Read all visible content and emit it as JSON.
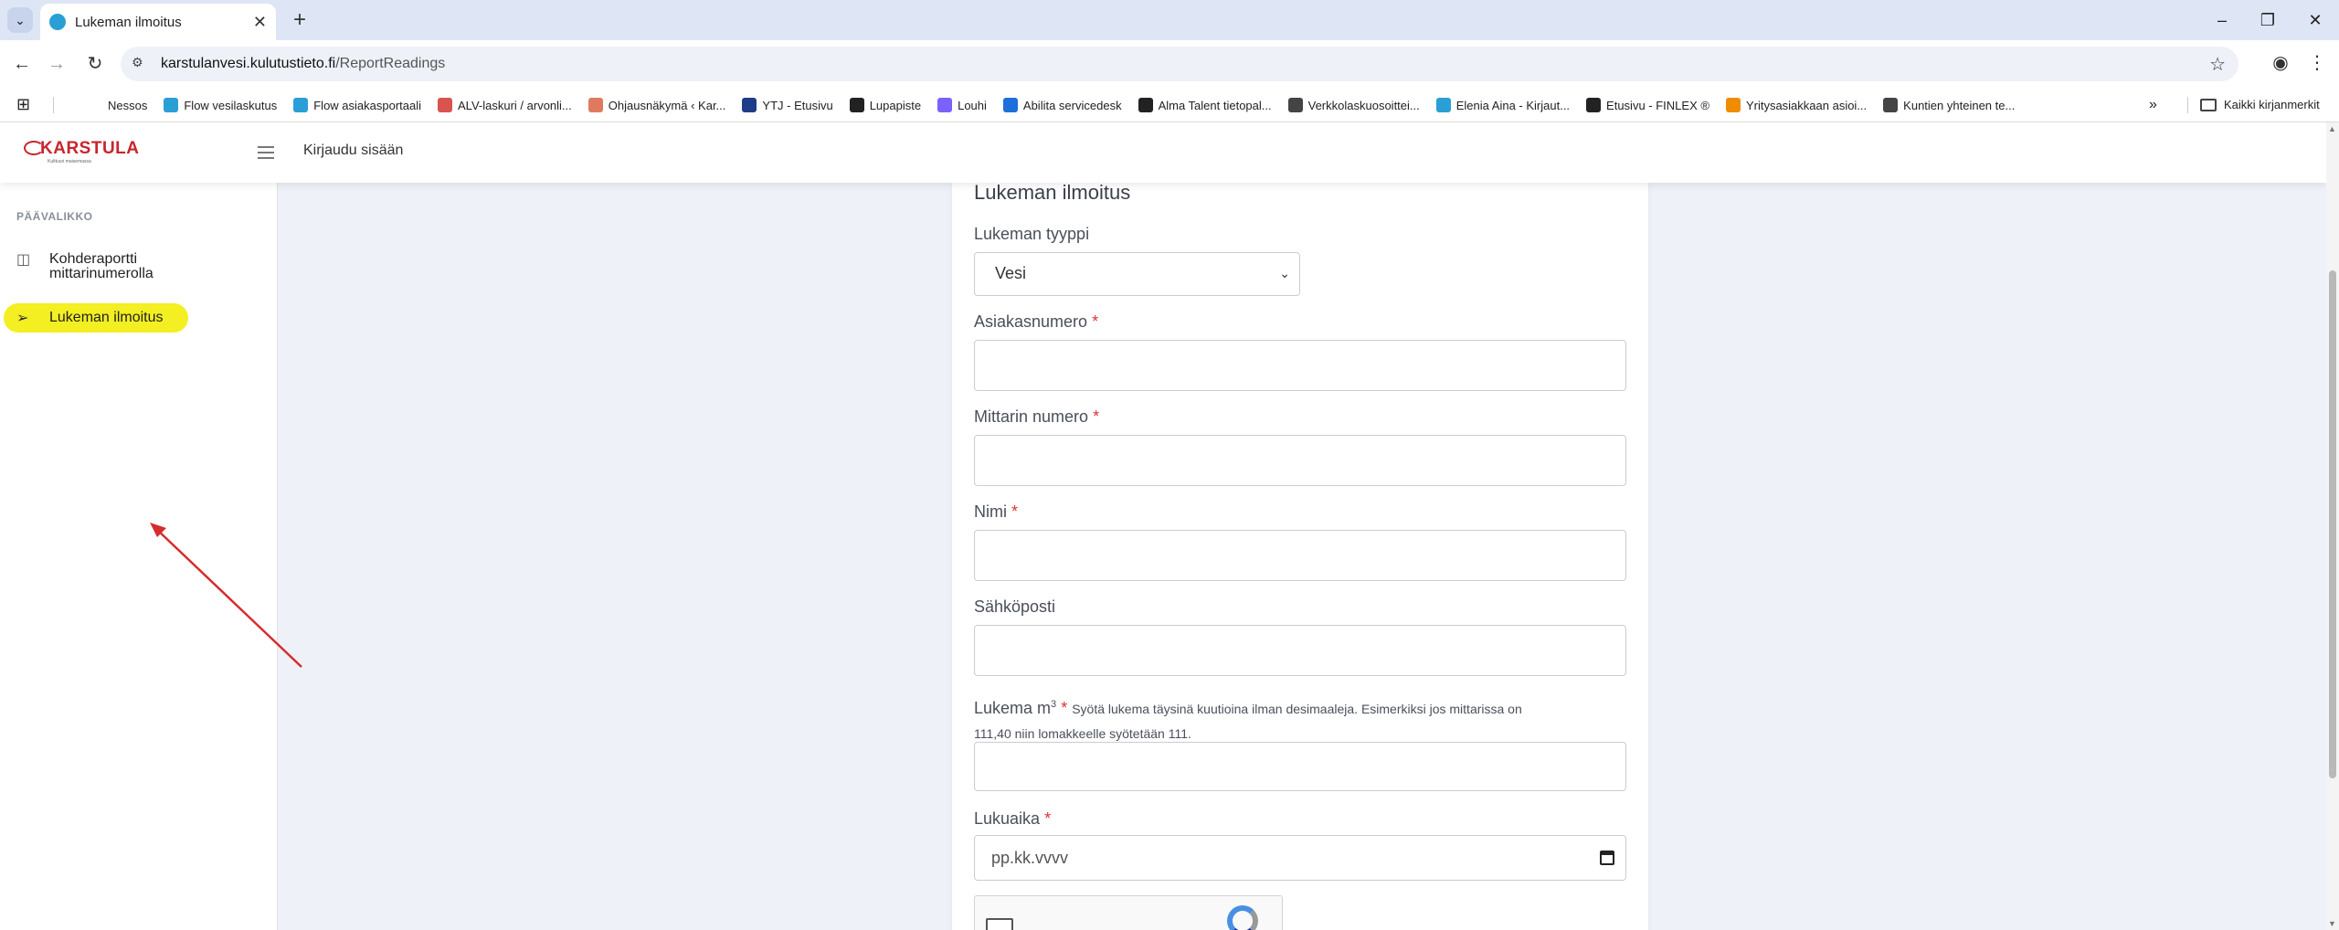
{
  "browser": {
    "tab_title": "Lukeman ilmoitus",
    "url_host": "karstulanvesi.kulutustieto.fi",
    "url_path": "/ReportReadings",
    "bookmarks": [
      {
        "label": "Nessos",
        "color": "#ffffff"
      },
      {
        "label": "Flow vesilaskutus",
        "color": "#2a9fd6"
      },
      {
        "label": "Flow asiakasportaali",
        "color": "#2a9fd6"
      },
      {
        "label": "ALV-laskuri / arvonli...",
        "color": "#d9534f"
      },
      {
        "label": "Ohjausnäkymä ‹ Kar...",
        "color": "#e07a5f"
      },
      {
        "label": "YTJ - Etusivu",
        "color": "#1f3c88"
      },
      {
        "label": "Lupapiste",
        "color": "#222222"
      },
      {
        "label": "Louhi",
        "color": "#7b61ff"
      },
      {
        "label": "Abilita servicedesk",
        "color": "#1e6fd9"
      },
      {
        "label": "Alma Talent tietopal...",
        "color": "#222222"
      },
      {
        "label": "Verkkolaskuosoittei...",
        "color": "#444444"
      },
      {
        "label": "Elenia Aina - Kirjaut...",
        "color": "#2a9fd6"
      },
      {
        "label": "Etusivu - FINLEX ®",
        "color": "#222222"
      },
      {
        "label": "Yritysasiakkaan asioi...",
        "color": "#f08c00"
      },
      {
        "label": "Kuntien yhteinen te...",
        "color": "#444444"
      }
    ],
    "all_bookmarks": "Kaikki kirjanmerkit"
  },
  "header": {
    "logo_text": "KARSTULA",
    "logo_sub": "Kulttuuri maisemassa",
    "login": "Kirjaudu sisään"
  },
  "sidebar": {
    "heading": "PÄÄVALIKKO",
    "items": [
      {
        "label_line1": "Kohderaportti",
        "label_line2": "mittarinumerolla",
        "icon": "book-icon"
      },
      {
        "label_line1": "Lukeman ilmoitus",
        "icon": "send-icon"
      }
    ]
  },
  "form": {
    "title": "Lukeman ilmoitus",
    "type_label": "Lukeman tyyppi",
    "type_value": "Vesi",
    "customer_label": "Asiakasnumero",
    "meter_label": "Mittarin numero",
    "name_label": "Nimi",
    "email_label": "Sähköposti",
    "reading_label": "Lukema m",
    "reading_sup": "3",
    "reading_hint_line1": "Syötä lukema täysinä kuutioina ilman desimaaleja. Esimerkiksi jos mittarissa on",
    "reading_hint_line2": "111,40 niin lomakkeelle syötetään 111.",
    "date_label": "Lukuaika",
    "date_placeholder": "pp.kk.vvvv",
    "required_mark": "*"
  },
  "colors": {
    "highlight": "#f3ef22",
    "arrow": "#d62c2c",
    "required": "#dd3333",
    "brand": "#c8252c"
  }
}
